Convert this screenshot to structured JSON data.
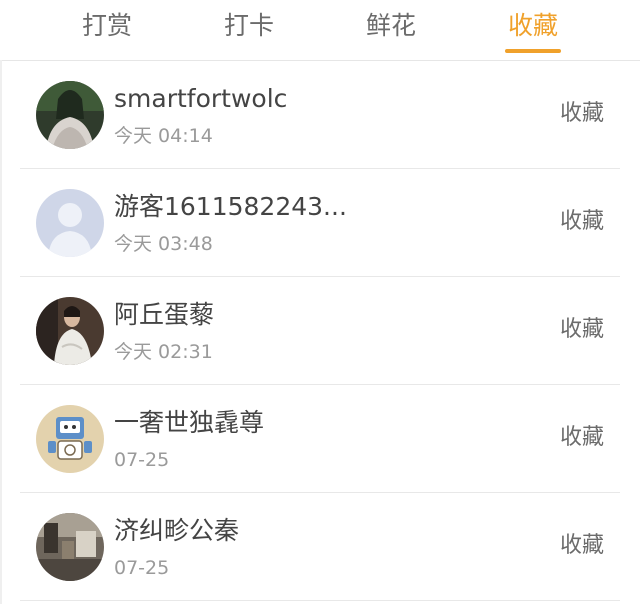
{
  "tabs": [
    {
      "label": "打赏",
      "active": false
    },
    {
      "label": "打卡",
      "active": false
    },
    {
      "label": "鲜花",
      "active": false
    },
    {
      "label": "收藏",
      "active": true
    }
  ],
  "accent_color": "#f0a12b",
  "list": [
    {
      "name": "smartfortwolc",
      "time": "今天 04:14",
      "action": "收藏",
      "avatar": "avatar-photo-woman-dark"
    },
    {
      "name": "游客1611582243...",
      "time": "今天 03:48",
      "action": "收藏",
      "avatar": "avatar-default-guest"
    },
    {
      "name": "阿丘蛋藜",
      "time": "今天 02:31",
      "action": "收藏",
      "avatar": "avatar-photo-woman-light"
    },
    {
      "name": "一奢世独毳尊",
      "time": "07-25",
      "action": "收藏",
      "avatar": "avatar-cartoon-blue"
    },
    {
      "name": "济纠畛公秦",
      "time": "07-25",
      "action": "收藏",
      "avatar": "avatar-photo-interior"
    }
  ]
}
